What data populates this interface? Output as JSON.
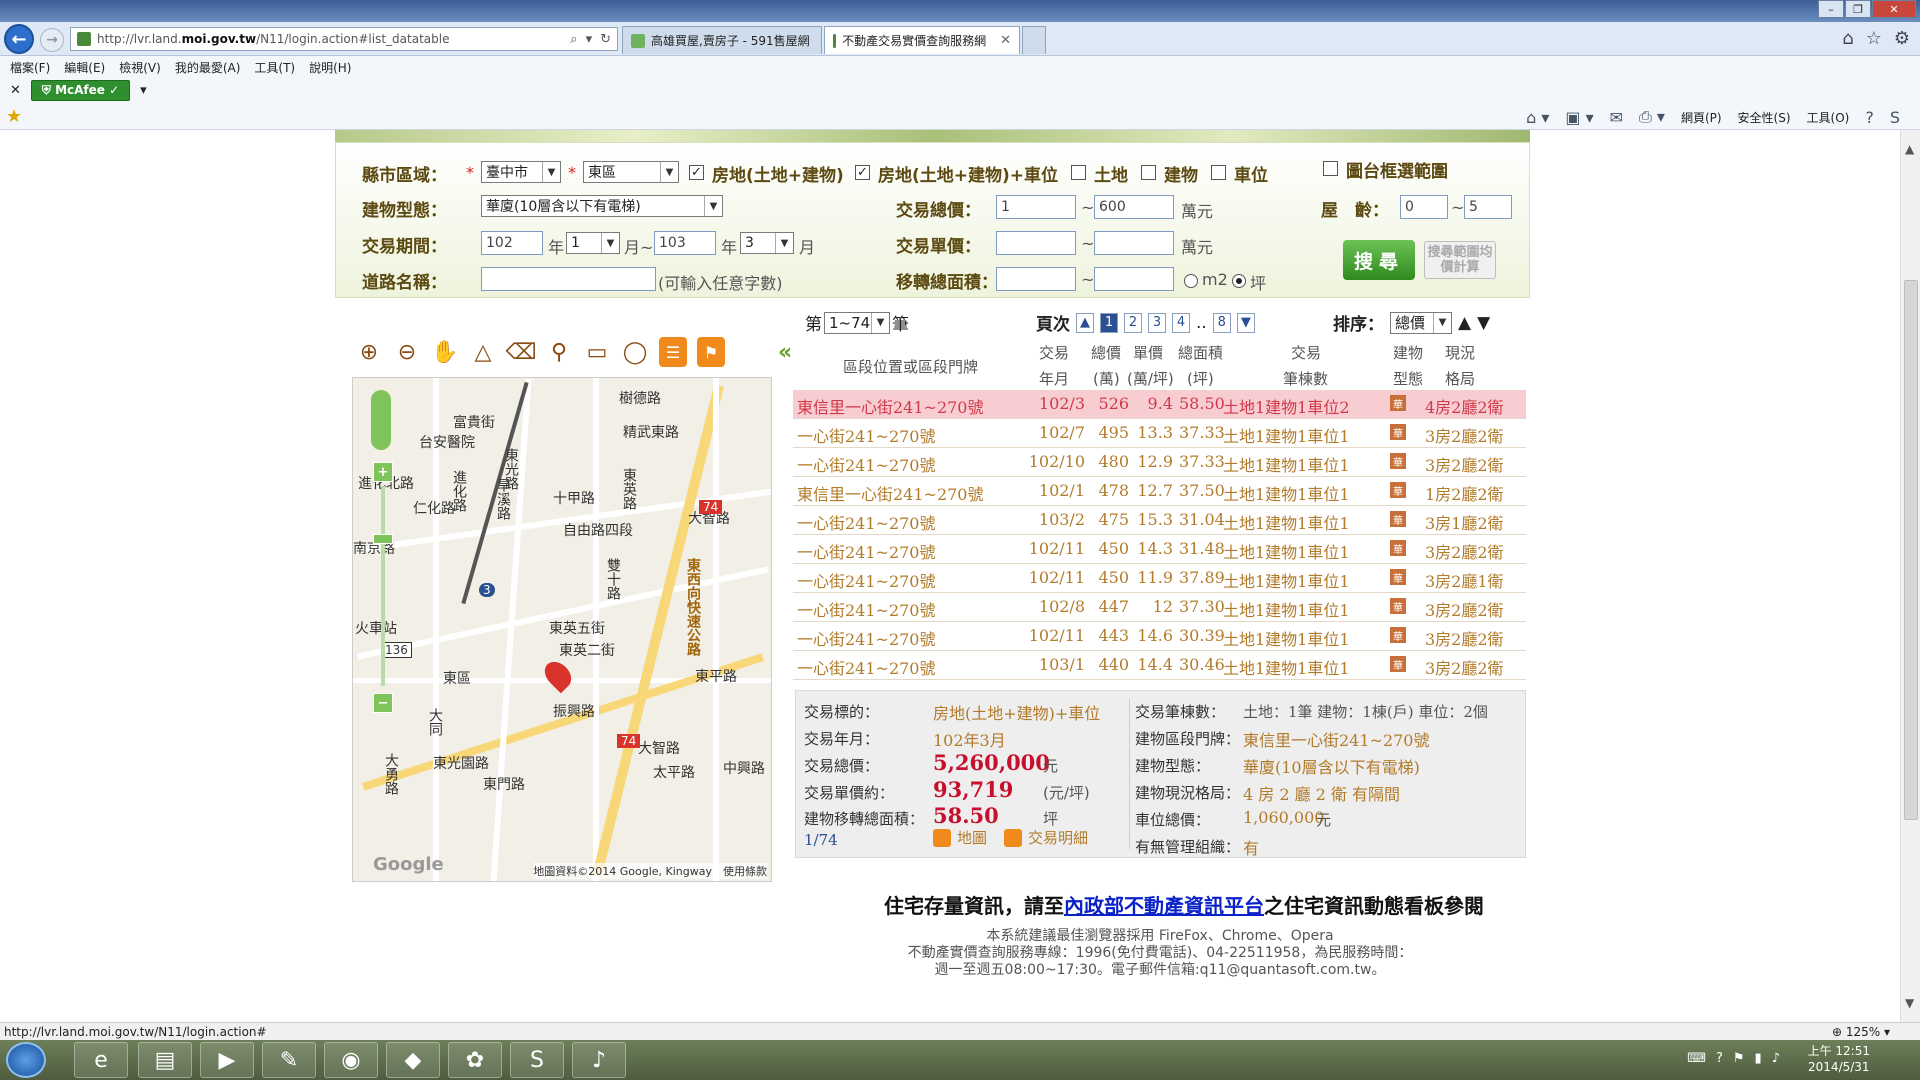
{
  "browser": {
    "url_prefix": "http://lvr.land.",
    "url_domain": "moi.gov.tw",
    "url_suffix": "/N11/login.action#list_datatable",
    "tabs": [
      {
        "label": "高雄買屋,賣房子 - 591售屋網",
        "active": false
      },
      {
        "label": "不動產交易實價查詢服務網",
        "active": true
      }
    ],
    "menu": [
      "檔案(F)",
      "編輯(E)",
      "檢視(V)",
      "我的最愛(A)",
      "工具(T)",
      "說明(H)"
    ],
    "addon": "McAfee",
    "commands": [
      "網頁(P)",
      "安全性(S)",
      "工具(O)"
    ],
    "status_url": "http://lvr.land.moi.gov.tw/N11/login.action#",
    "zoom": "125%"
  },
  "form": {
    "city_label": "縣市區域：",
    "city": "臺中市",
    "district": "東區",
    "opt_land_building": "房地(土地+建物)",
    "opt_land_building_parking": "房地(土地+建物)+車位",
    "opt_land": "土地",
    "opt_building": "建物",
    "opt_parking": "車位",
    "opt_map_range": "圖台框選範圍",
    "type_label": "建物型態：",
    "type_value": "華廈(10層含以下有電梯)",
    "total_price_label": "交易總價：",
    "total_price_min": "1",
    "total_price_max": "600",
    "price_unit": "萬元",
    "age_label": "屋　齡：",
    "age_min": "0",
    "age_max": "5",
    "period_label": "交易期間：",
    "period_start_year": "102",
    "year_unit": "年",
    "period_start_month": "1",
    "month_sep": "月~",
    "period_end_year": "103",
    "period_end_month": "3",
    "month_unit": "月",
    "unit_price_label": "交易單價：",
    "road_label": "道路名稱：",
    "road_hint": "(可輸入任意字數)",
    "area_label": "移轉總面積：",
    "area_m2": "m2",
    "area_ping": "坪",
    "tilde": "~",
    "search_button": "搜尋",
    "avg_button": "搜尋範圍均價計算"
  },
  "results": {
    "range_prefix": "第",
    "range_value": "1~74",
    "range_suffix": "筆",
    "page_label": "頁次",
    "pages": [
      "1",
      "2",
      "3",
      "4",
      "..",
      "8"
    ],
    "sort_label": "排序：",
    "sort_value": "總價",
    "headers": {
      "addr": "區段位置或區段門牌",
      "ym": [
        "交易",
        "年月"
      ],
      "tp": [
        "總價",
        "(萬)"
      ],
      "up": [
        "單價",
        "(萬/坪)"
      ],
      "ar": [
        "總面積",
        "(坪)"
      ],
      "cnt": [
        "交易",
        "筆棟數"
      ],
      "bt": [
        "建物",
        "型態"
      ],
      "lay": [
        "現況",
        "格局"
      ]
    },
    "rows": [
      {
        "addr": "東信里一心街241~270號",
        "ym": "102/3",
        "tp": "526",
        "up": "9.4",
        "ar": "58.50",
        "cnt": "土地1建物1車位2",
        "bt": "華",
        "lay": "4房2廳2衛",
        "selected": true
      },
      {
        "addr": "一心街241~270號",
        "ym": "102/7",
        "tp": "495",
        "up": "13.3",
        "ar": "37.33",
        "cnt": "土地1建物1車位1",
        "bt": "華",
        "lay": "3房2廳2衛"
      },
      {
        "addr": "一心街241~270號",
        "ym": "102/10",
        "tp": "480",
        "up": "12.9",
        "ar": "37.33",
        "cnt": "土地1建物1車位1",
        "bt": "華",
        "lay": "3房2廳2衛"
      },
      {
        "addr": "東信里一心街241~270號",
        "ym": "102/1",
        "tp": "478",
        "up": "12.7",
        "ar": "37.50",
        "cnt": "土地1建物1車位1",
        "bt": "華",
        "lay": "1房2廳2衛"
      },
      {
        "addr": "一心街241~270號",
        "ym": "103/2",
        "tp": "475",
        "up": "15.3",
        "ar": "31.04",
        "cnt": "土地1建物1車位1",
        "bt": "華",
        "lay": "3房1廳2衛"
      },
      {
        "addr": "一心街241~270號",
        "ym": "102/11",
        "tp": "450",
        "up": "14.3",
        "ar": "31.48",
        "cnt": "土地1建物1車位1",
        "bt": "華",
        "lay": "3房2廳2衛"
      },
      {
        "addr": "一心街241~270號",
        "ym": "102/11",
        "tp": "450",
        "up": "11.9",
        "ar": "37.89",
        "cnt": "土地1建物1車位1",
        "bt": "華",
        "lay": "3房2廳1衛"
      },
      {
        "addr": "一心街241~270號",
        "ym": "102/8",
        "tp": "447",
        "up": "12",
        "ar": "37.30",
        "cnt": "土地1建物1車位1",
        "bt": "華",
        "lay": "3房2廳2衛"
      },
      {
        "addr": "一心街241~270號",
        "ym": "102/11",
        "tp": "443",
        "up": "14.6",
        "ar": "30.39",
        "cnt": "土地1建物1車位1",
        "bt": "華",
        "lay": "3房2廳2衛"
      },
      {
        "addr": "一心街241~270號",
        "ym": "103/1",
        "tp": "440",
        "up": "14.4",
        "ar": "30.46",
        "cnt": "土地1建物1車位1",
        "bt": "華",
        "lay": "3房2廳2衛"
      }
    ]
  },
  "detail": {
    "l_target": "交易標的：",
    "v_target": "房地(土地+建物)+車位",
    "l_ym": "交易年月：",
    "v_ym": "102年3月",
    "l_total": "交易總價：",
    "v_total": "5,260,000",
    "u_total": "元",
    "l_unit": "交易單價約：",
    "v_unit": "93,719",
    "u_unit": "(元/坪)",
    "l_area": "建物移轉總面積：",
    "v_area": "58.50",
    "u_area": "坪",
    "index": "1/74",
    "link_map": "地圖",
    "link_detail": "交易明細",
    "l_count": "交易筆棟數：",
    "v_count": "土地：1筆 建物：1棟(戶) 車位：2個",
    "l_addr": "建物區段門牌：",
    "v_addr": "東信里一心街241~270號",
    "l_type": "建物型態：",
    "v_type": "華廈(10層含以下有電梯)",
    "l_layout": "建物現況格局：",
    "v_layout": "4 房 2 廳 2 衛 有隔間",
    "l_parking": "車位總價：",
    "v_parking": "1,060,000",
    "u_parking": "元",
    "l_mgmt": "有無管理組織：",
    "v_mgmt": "有"
  },
  "notice": {
    "pre": "住宅存量資訊，請至",
    "link": "內政部不動產資訊平台",
    "post": "之住宅資訊動態看板參閱"
  },
  "footer": {
    "line1": "本系統建議最佳瀏覽器採用 FireFox、Chrome、Opera",
    "line2": "不動產實價查詢服務專線：1996(免付費電話)、04-22511958，為民服務時間：",
    "line3": "週一至週五08:00~17:30。電子郵件信箱:q11@quantasoft.com.tw。"
  },
  "map": {
    "credit": "地圖資料©2014 Google, Kingway　使用條款",
    "google": "Google",
    "labels": [
      "富貴街",
      "台安醫院",
      "進化路",
      "仁化路",
      "精武東路",
      "樹德路",
      "十甲路",
      "東英路",
      "自由路四段",
      "東光路",
      "大智路",
      "東西向快速公路",
      "進化北路",
      "東區",
      "振興路",
      "東平路",
      "大智路",
      "中興路",
      "大勇路",
      "雙十路",
      "旱溪路",
      "南京路",
      "東光園路",
      "東門路",
      "火車站",
      "大同",
      "東英五街",
      "東英二街",
      "太平路"
    ],
    "road_num_3": "3",
    "road_num_74": "74",
    "road_num_136": "136"
  },
  "system": {
    "time": "上午 12:51",
    "date": "2014/5/31"
  }
}
